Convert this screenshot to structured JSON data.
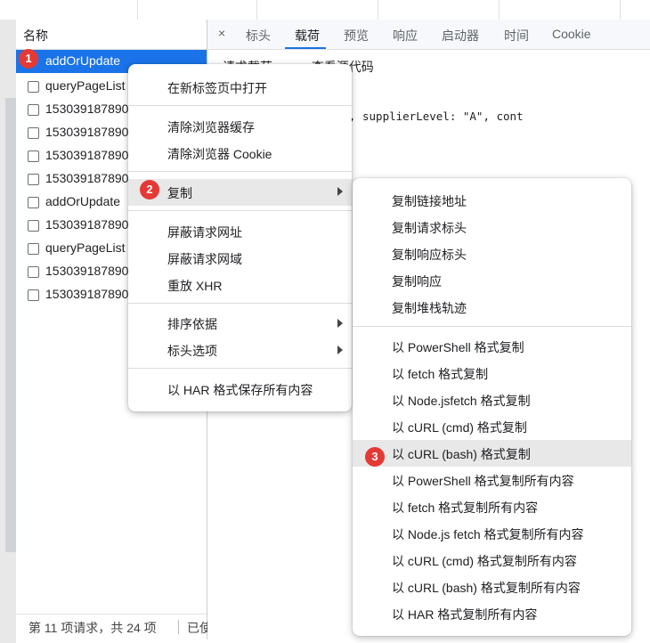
{
  "list": {
    "header": "名称",
    "rows": [
      {
        "label": "addOrUpdate",
        "selected": true
      },
      {
        "label": "queryPageList",
        "selected": false
      },
      {
        "label": "153039187890",
        "selected": false
      },
      {
        "label": "153039187890",
        "selected": false
      },
      {
        "label": "153039187890",
        "selected": false
      },
      {
        "label": "153039187890",
        "selected": false
      },
      {
        "label": "addOrUpdate",
        "selected": false
      },
      {
        "label": "153039187890",
        "selected": false
      },
      {
        "label": "queryPageList",
        "selected": false
      },
      {
        "label": "153039187890",
        "selected": false
      },
      {
        "label": "153039187890",
        "selected": false
      }
    ],
    "footer": "第 11 项请求，共 24 项",
    "footer_more": "已使"
  },
  "details": {
    "close": "×",
    "tabs": [
      "标头",
      "载荷",
      "预览",
      "响应",
      "启动器",
      "时间",
      "Cookie"
    ],
    "active_tab": "载荷",
    "payload_title": "▾ 请求载荷",
    "view_source": "查看源代码",
    "payload_body": "{supplierName: \"大米\", supplierLevel: \"A\", cont"
  },
  "badges": [
    "1",
    "2",
    "3"
  ],
  "context_menu": {
    "items": [
      "在新标签页中打开",
      "清除浏览器缓存",
      "清除浏览器 Cookie",
      "复制",
      "屏蔽请求网址",
      "屏蔽请求网域",
      "重放 XHR",
      "排序依据",
      "标头选项",
      "以 HAR 格式保存所有内容"
    ]
  },
  "copy_submenu": {
    "items": [
      "复制链接地址",
      "复制请求标头",
      "复制响应标头",
      "复制响应",
      "复制堆栈轨迹",
      "以 PowerShell 格式复制",
      "以 fetch 格式复制",
      "以 Node.jsfetch 格式复制",
      "以 cURL (cmd) 格式复制",
      "以 cURL (bash) 格式复制",
      "以 PowerShell 格式复制所有内容",
      "以 fetch 格式复制所有内容",
      "以 Node.js fetch 格式复制所有内容",
      "以 cURL (cmd) 格式复制所有内容",
      "以 cURL (bash) 格式复制所有内容",
      "以 HAR 格式复制所有内容"
    ],
    "highlighted": "以 cURL (bash) 格式复制"
  },
  "colors": {
    "accent": "#1a73e8",
    "badge": "#e53935",
    "highlight": "#e8e8e8"
  }
}
